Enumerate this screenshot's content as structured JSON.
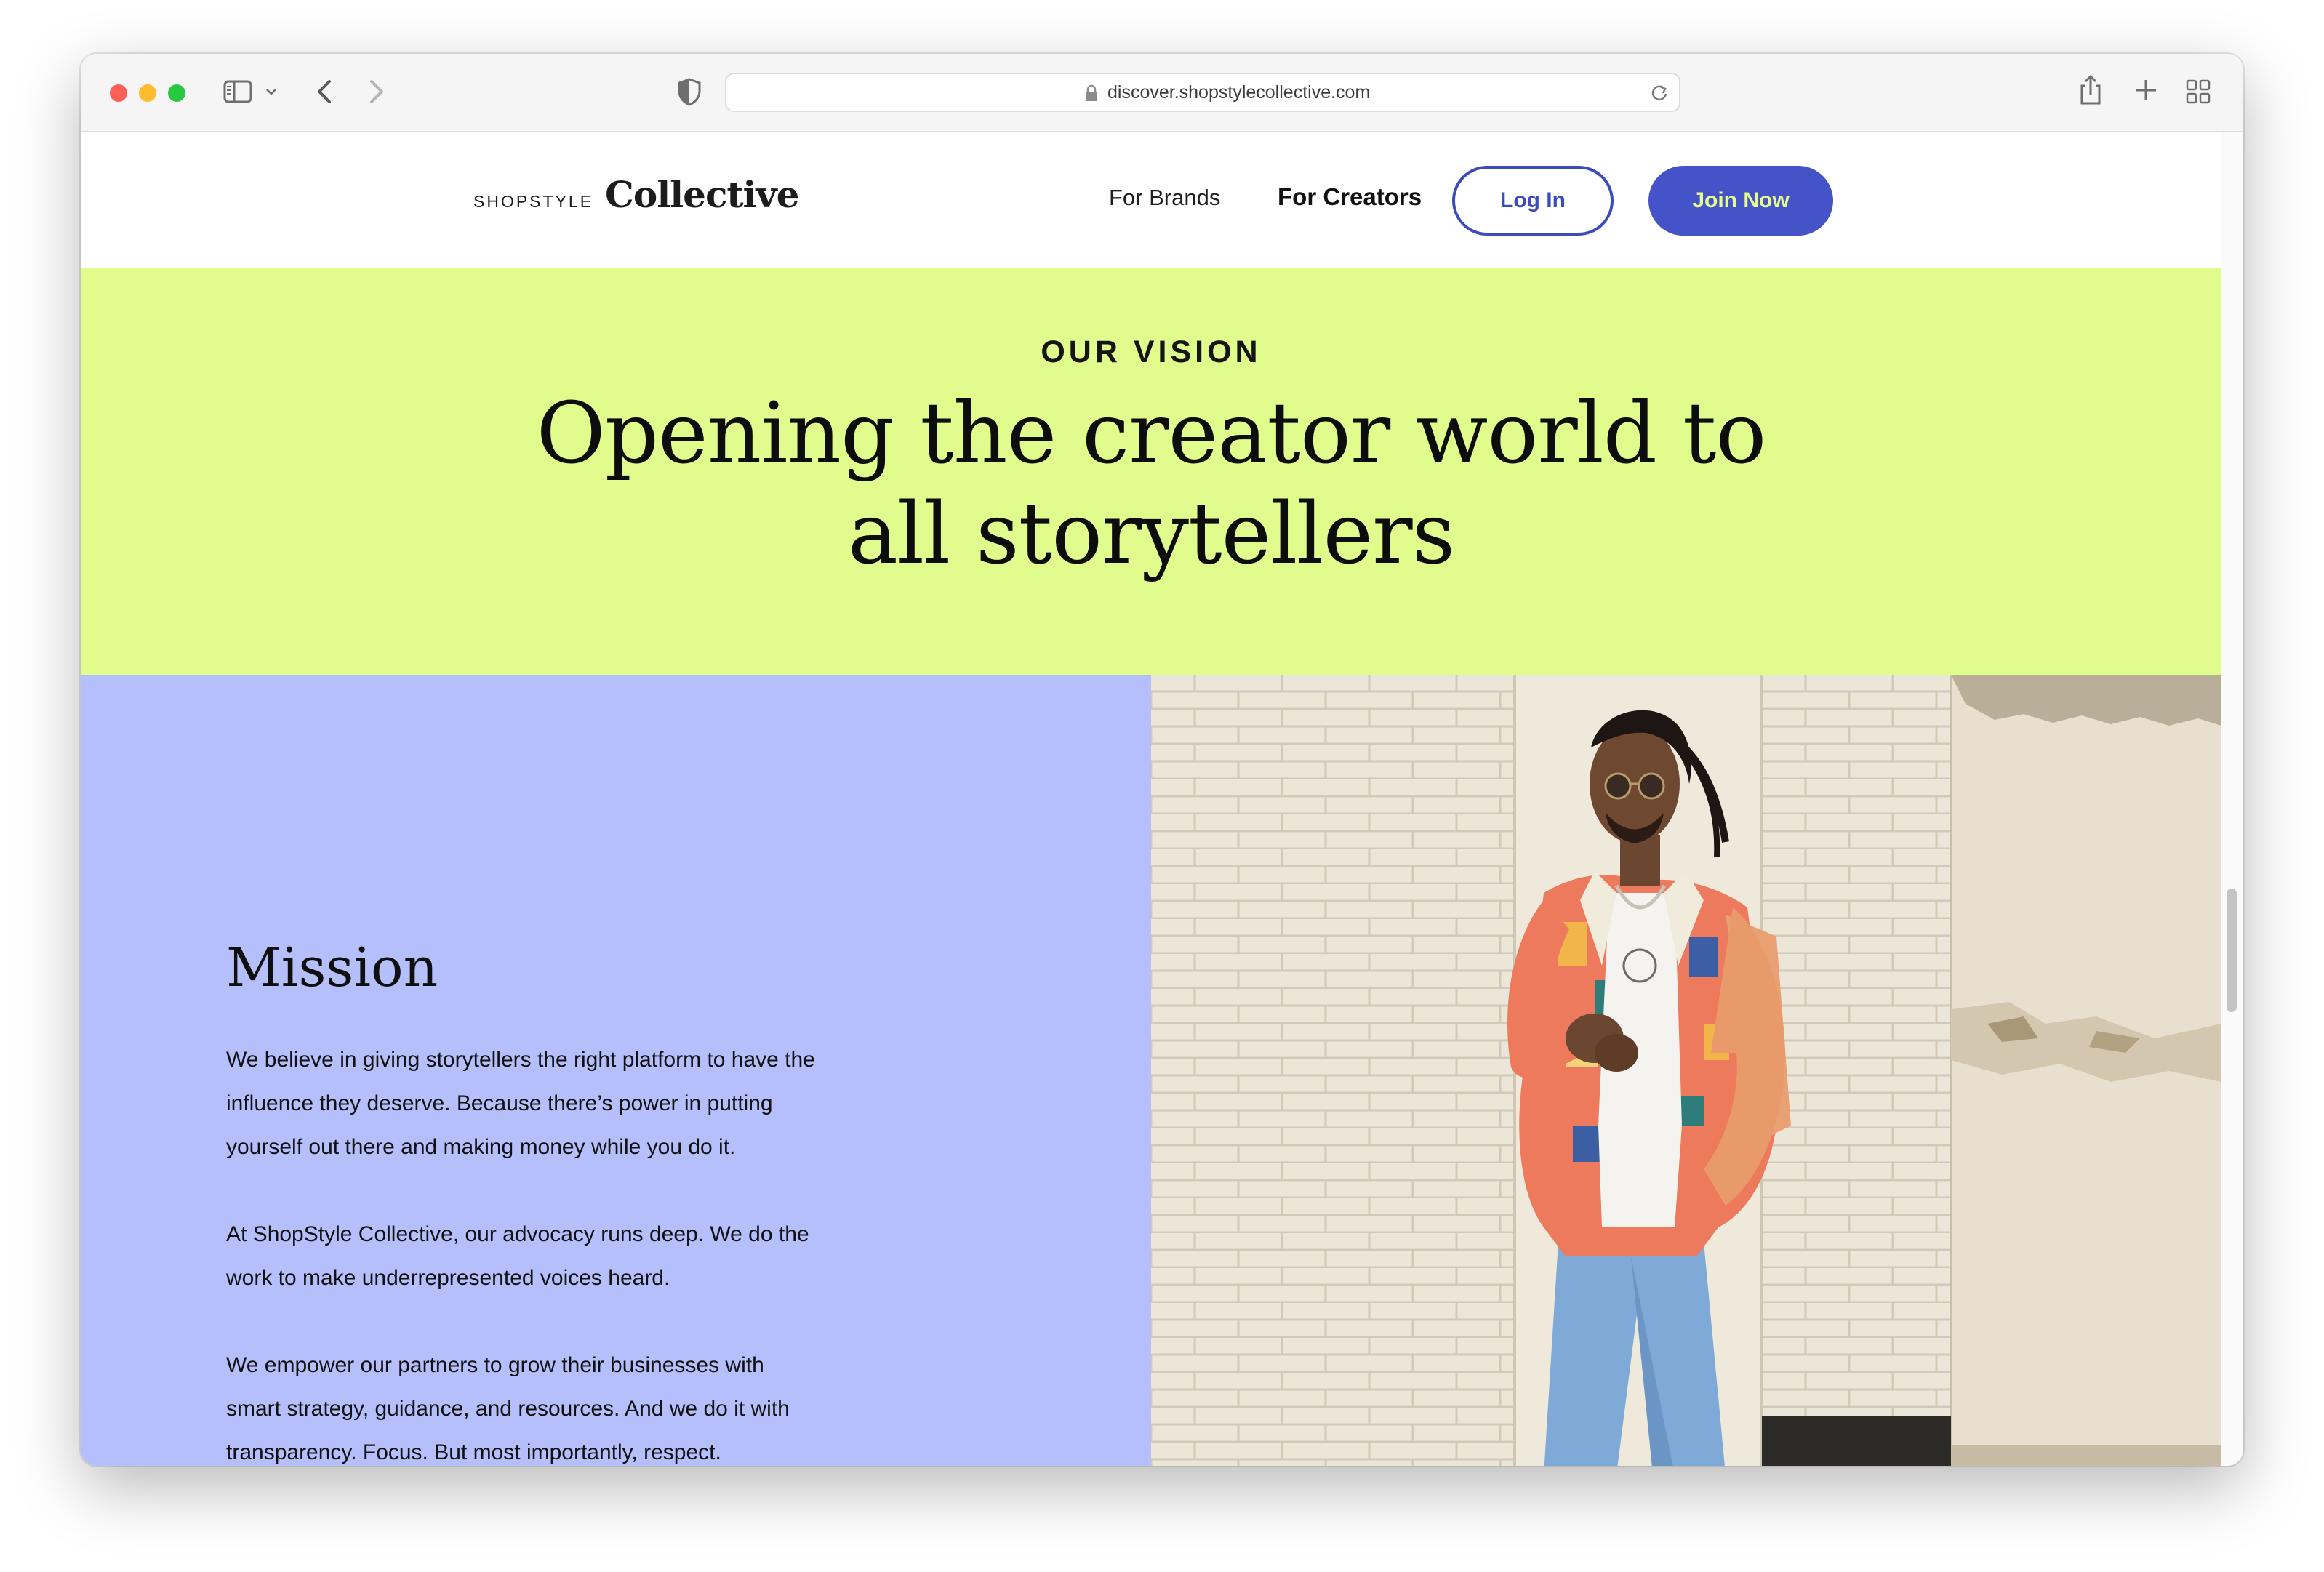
{
  "browser": {
    "url": "discover.shopstylecollective.com"
  },
  "site": {
    "logo_small": "SHOPSTYLE",
    "logo_big": "Collective",
    "nav": {
      "for_brands": "For Brands",
      "for_creators": "For Creators",
      "login": "Log In",
      "join": "Join Now"
    },
    "colors": {
      "vision_bg": "#e0fc8c",
      "mission_bg": "#b4bffc",
      "brand_blue": "#4453c8",
      "join_text": "#e5ff8a"
    }
  },
  "vision": {
    "eyebrow": "OUR VISION",
    "title_line1": "Opening the creator world to",
    "title_line2": "all storytellers"
  },
  "mission": {
    "title": "Mission",
    "paragraphs": [
      [
        "We believe in giving storytellers the right platform to have the",
        "influence they deserve. Because there’s power in putting",
        "yourself out there and making money while you do it."
      ],
      [
        "At ShopStyle Collective, our advocacy runs deep. We do the",
        "work to make underrepresented voices heard."
      ],
      [
        "We empower our partners to grow their businesses with",
        "smart strategy, guidance, and resources. And we do it with",
        "transparency. Focus. But most importantly, respect."
      ]
    ]
  },
  "icons": {
    "sidebar": "sidebar-icon",
    "back": "chevron-left-icon",
    "forward": "chevron-right-icon",
    "privacy": "shield-icon",
    "lock": "lock-icon",
    "reload": "reload-icon",
    "share": "share-icon",
    "new_tab": "plus-icon",
    "tab_overview": "grid-icon"
  }
}
